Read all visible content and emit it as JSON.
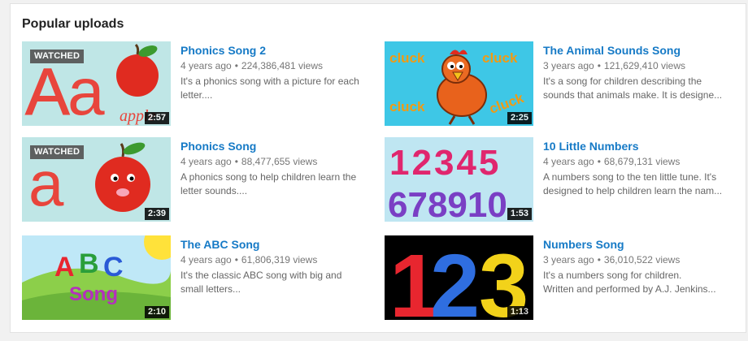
{
  "section": {
    "title": "Popular uploads"
  },
  "videos": [
    {
      "title": "Phonics Song 2",
      "age": "4 years ago",
      "views": "224,386,481 views",
      "desc_line1": "It's a phonics song with a picture for each",
      "desc_line2": "letter....",
      "duration": "2:57",
      "watched": "WATCHED",
      "thumb_texts": {
        "big1": "A",
        "big2": "a",
        "word": "apple"
      }
    },
    {
      "title": "The Animal Sounds Song",
      "age": "3 years ago",
      "views": "121,629,410 views",
      "desc_line1": "It's a song for children describing the",
      "desc_line2": "sounds that animals make. It is designe...",
      "duration": "2:25",
      "thumb_texts": {
        "word": "cluck"
      }
    },
    {
      "title": "Phonics Song",
      "age": "4 years ago",
      "views": "88,477,655 views",
      "desc_line1": "A phonics song to help children learn the",
      "desc_line2": "letter sounds....",
      "duration": "2:39",
      "watched": "WATCHED",
      "thumb_texts": {
        "big1": "a"
      }
    },
    {
      "title": "10 Little Numbers",
      "age": "4 years ago",
      "views": "68,679,131 views",
      "desc_line1": "A numbers song to the ten little tune. It's",
      "desc_line2": "designed to help children learn the nam...",
      "duration": "1:53",
      "thumb_texts": {
        "row1": "12345",
        "row2": "678910"
      }
    },
    {
      "title": "The ABC Song",
      "age": "4 years ago",
      "views": "61,806,319 views",
      "desc_line1": "It's the classic ABC song with big and",
      "desc_line2": "small letters...",
      "duration": "2:10",
      "thumb_texts": {
        "l1": "A",
        "l2": "B",
        "l3": "C",
        "word": "Song"
      }
    },
    {
      "title": "Numbers Song",
      "age": "3 years ago",
      "views": "36,010,522 views",
      "desc_line1": "It's a numbers song for children.",
      "desc_line2": "Written and performed by A.J. Jenkins...",
      "duration": "1:13",
      "thumb_texts": {
        "d1": "1",
        "d2": "2",
        "d3": "3"
      }
    }
  ],
  "colors": {
    "link": "#167ac6",
    "meta": "#767676"
  }
}
